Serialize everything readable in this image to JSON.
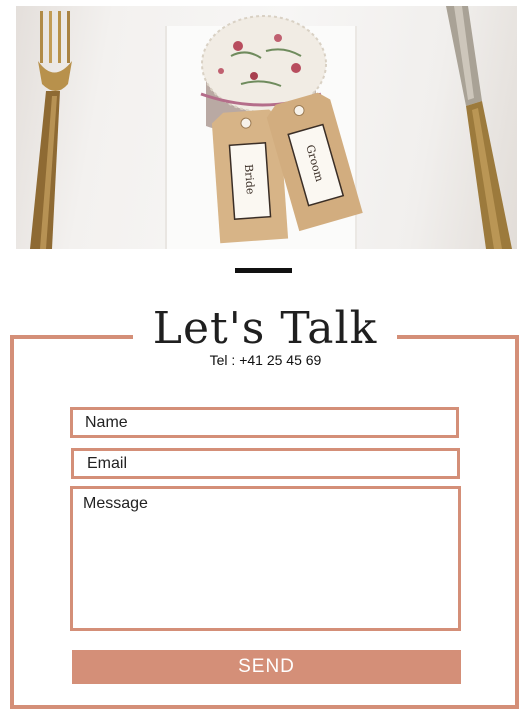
{
  "hero": {
    "tag_left_text": "Bride",
    "tag_right_text": "Groom"
  },
  "contact": {
    "title": "Let's Talk",
    "phone": "Tel : +41 25 45 69"
  },
  "form": {
    "name_placeholder": "Name",
    "email_placeholder": "Email",
    "message_placeholder": "Message",
    "send_label": "SEND"
  },
  "colors": {
    "accent": "#d48f78",
    "text": "#1f1f1f",
    "divider": "#111111"
  }
}
